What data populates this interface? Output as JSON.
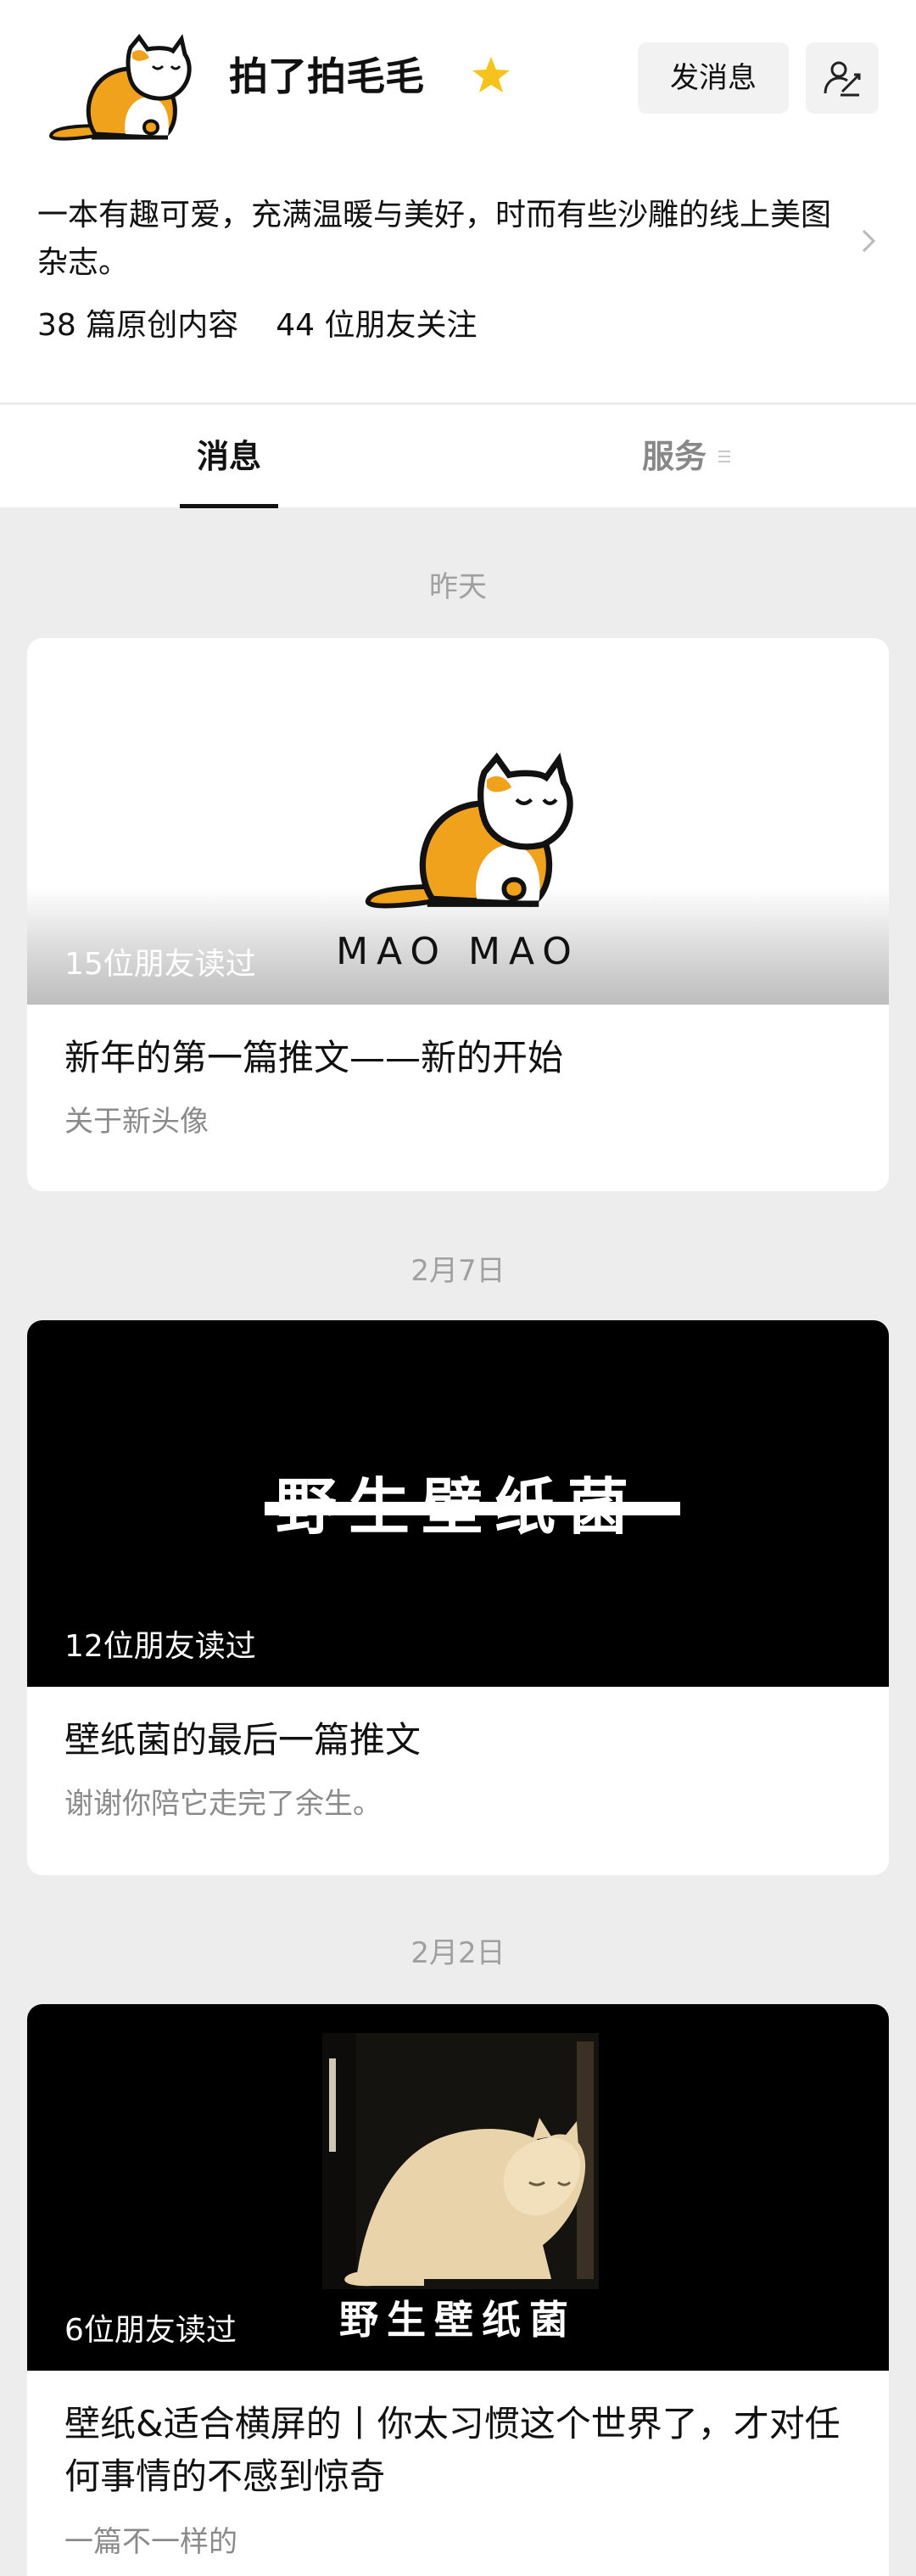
{
  "header": {
    "account_name": "拍了拍毛毛",
    "send_message_label": "发消息",
    "description": "一本有趣可爱，充满温暖与美好，时而有些沙雕的线上美图杂志。",
    "stats": {
      "articles": "38 篇原创内容",
      "followers": "44 位朋友关注"
    }
  },
  "tabs": {
    "messages": "消息",
    "services": "服务"
  },
  "feed": [
    {
      "date": "昨天",
      "cover_text": "MAO MAO",
      "reads": "15位朋友读过",
      "title": "新年的第一篇推文——新的开始",
      "subtitle": "关于新头像"
    },
    {
      "date": "2月7日",
      "cover_text": "野生壁纸菌",
      "reads": "12位朋友读过",
      "title": "壁纸菌的最后一篇推文",
      "subtitle": "谢谢你陪它走完了余生。"
    },
    {
      "date": "2月2日",
      "cover_text": "野生壁纸菌",
      "reads": "6位朋友读过",
      "title": "壁纸&适合横屏的丨你太习惯这个世界了，才对任何事情的不感到惊奇",
      "subtitle": "一篇不一样的"
    }
  ],
  "colors": {
    "accent_star": "#f6c21c",
    "cat_orange": "#f0a21c",
    "background": "#ededed"
  },
  "icons": {
    "verified": "star-icon",
    "profile": "person-sign-icon",
    "more": "chevron-right-icon",
    "services_menu": "menu-lines-icon"
  }
}
